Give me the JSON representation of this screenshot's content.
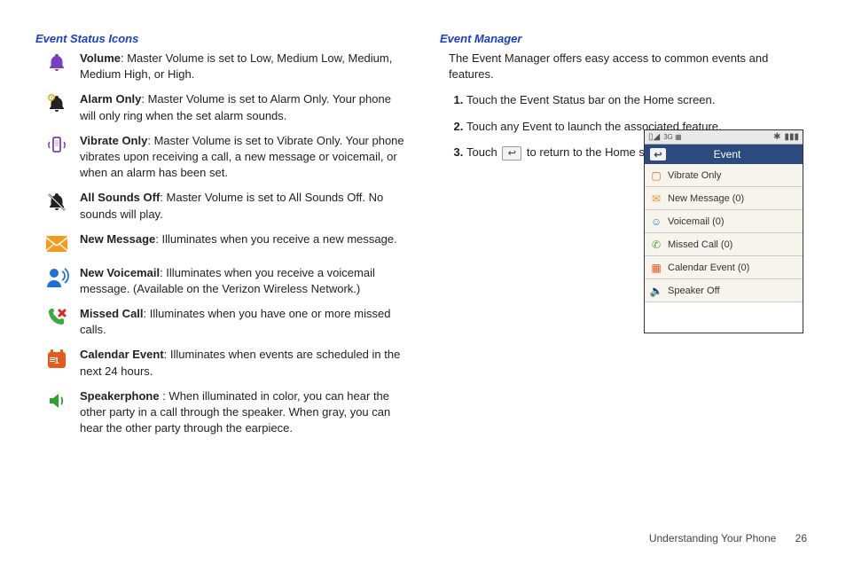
{
  "left": {
    "title": "Event Status Icons",
    "items": [
      {
        "term": "Volume",
        "desc": ": Master Volume is set to Low, Medium Low, Medium, Medium High, or High."
      },
      {
        "term": "Alarm Only",
        "desc": ": Master Volume is set to Alarm Only.  Your phone will only ring when the set alarm sounds."
      },
      {
        "term": "Vibrate Only",
        "desc": ": Master Volume is set to Vibrate Only. Your phone vibrates upon receiving a call, a new message or voicemail, or when an alarm has been set."
      },
      {
        "term": "All Sounds Off",
        "desc": ": Master Volume is set to All Sounds Off. No sounds will play."
      },
      {
        "term": "New Message",
        "desc": ": Illuminates when you receive a new message."
      },
      {
        "term": "New Voicemail",
        "desc": ": Illuminates when you receive a voicemail message. (Available on the Verizon Wireless Network.)"
      },
      {
        "term": "Missed Call",
        "desc": ": Illuminates when you have one or more missed calls."
      },
      {
        "term": "Calendar Event",
        "desc": ": Illuminates when events are scheduled in the next 24 hours."
      },
      {
        "term": "Speakerphone ",
        "desc": ": When illuminated in color, you can hear the other party in a call through the speaker. When gray, you can hear the other party through the earpiece."
      }
    ]
  },
  "right": {
    "title": "Event Manager",
    "intro": "The Event Manager offers easy access to common events and features.",
    "steps": {
      "s1": "Touch the Event Status bar on the Home screen.",
      "s2": "Touch any Event to launch the associated feature.",
      "s3a": "Touch ",
      "s3b": " to return to the Home screen."
    }
  },
  "phone": {
    "header": "Event",
    "items": [
      "Vibrate Only",
      "New Message (0)",
      "Voicemail (0)",
      "Missed Call (0)",
      "Calendar Event (0)",
      "Speaker Off"
    ]
  },
  "footer": {
    "chapter": "Understanding Your Phone",
    "page": "26"
  }
}
